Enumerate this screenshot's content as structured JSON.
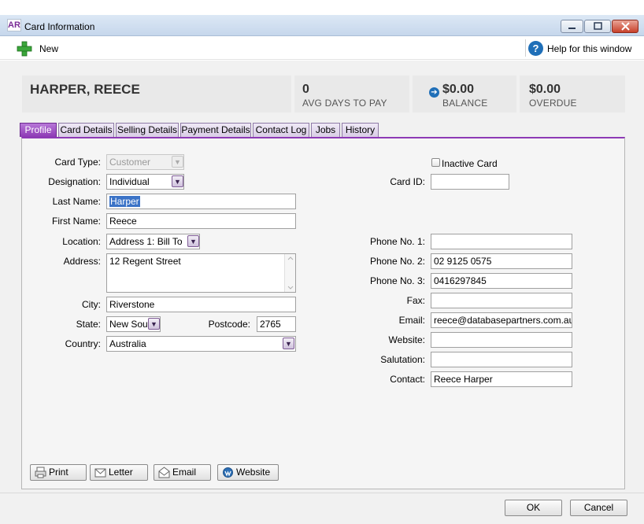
{
  "window": {
    "title": "Card Information",
    "app_logo": "AR"
  },
  "toolbar": {
    "new_label": "New",
    "help_label": "Help for this window",
    "help_icon": "?"
  },
  "summary": {
    "name": "HARPER, REECE",
    "avg_days_value": "0",
    "avg_days_label": "AVG DAYS TO PAY",
    "balance_value": "$0.00",
    "balance_label": "BALANCE",
    "overdue_value": "$0.00",
    "overdue_label": "OVERDUE"
  },
  "tabs": [
    {
      "label": "Profile"
    },
    {
      "label": "Card Details"
    },
    {
      "label": "Selling Details"
    },
    {
      "label": "Payment Details"
    },
    {
      "label": "Contact Log"
    },
    {
      "label": "Jobs"
    },
    {
      "label": "History"
    }
  ],
  "form": {
    "card_type_label": "Card Type:",
    "card_type_value": "Customer",
    "designation_label": "Designation:",
    "designation_value": "Individual",
    "last_name_label": "Last Name:",
    "last_name_value": "Harper",
    "first_name_label": "First Name:",
    "first_name_value": "Reece",
    "location_label": "Location:",
    "location_value": "Address 1: Bill To",
    "address_label": "Address:",
    "address_value": "12 Regent Street",
    "city_label": "City:",
    "city_value": "Riverstone",
    "state_label": "State:",
    "state_value": "New South Wales",
    "postcode_label": "Postcode:",
    "postcode_value": "2765",
    "country_label": "Country:",
    "country_value": "Australia",
    "inactive_label": "Inactive Card",
    "card_id_label": "Card ID:",
    "card_id_value": "",
    "phone1_label": "Phone No. 1:",
    "phone1_value": "",
    "phone2_label": "Phone No. 2:",
    "phone2_value": "02 9125 0575",
    "phone3_label": "Phone No. 3:",
    "phone3_value": "0416297845",
    "fax_label": "Fax:",
    "fax_value": "",
    "email_label": "Email:",
    "email_value": "reece@databasepartners.com.au",
    "website_label": "Website:",
    "website_value": "",
    "salutation_label": "Salutation:",
    "salutation_value": "",
    "contact_label": "Contact:",
    "contact_value": "Reece Harper"
  },
  "actions": {
    "print": "Print",
    "letter": "Letter",
    "email": "Email",
    "website": "Website"
  },
  "footer": {
    "ok": "OK",
    "cancel": "Cancel"
  },
  "colors": {
    "accent": "#8d3ab5",
    "link_blue": "#1f6fb8"
  }
}
